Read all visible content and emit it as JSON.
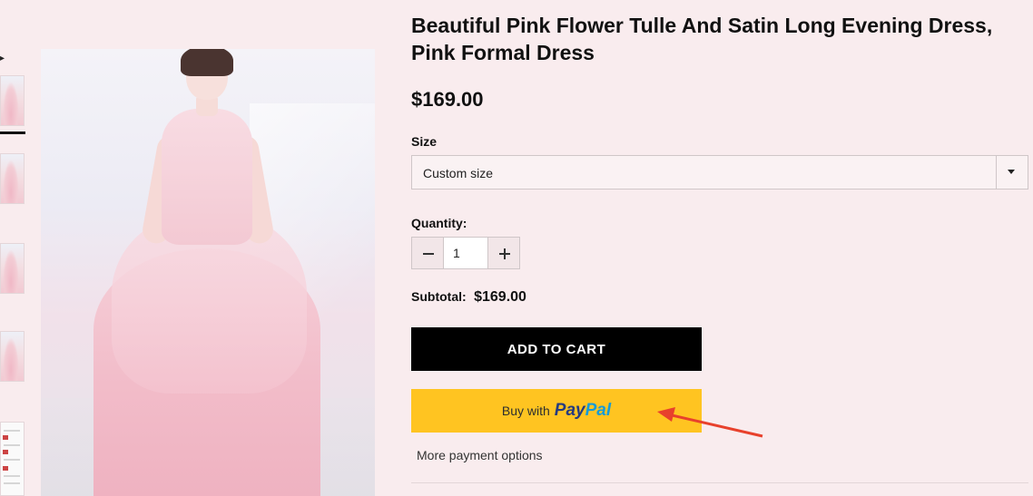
{
  "product": {
    "title": "Beautiful Pink Flower Tulle And Satin Long Evening Dress, Pink Formal Dress",
    "price": "$169.00"
  },
  "size": {
    "label": "Size",
    "selected": "Custom size"
  },
  "quantity": {
    "label": "Quantity:",
    "value": "1"
  },
  "subtotal": {
    "label": "Subtotal:",
    "value": "$169.00"
  },
  "buttons": {
    "add_to_cart": "ADD TO CART",
    "paypal_prefix": "Buy with",
    "paypal_brand_1": "Pay",
    "paypal_brand_2": "Pal",
    "more_payment": "More payment options"
  },
  "colors": {
    "background": "#f9ecee",
    "add_to_cart_bg": "#000000",
    "paypal_bg": "#ffc421",
    "annotation_arrow": "#e8412c"
  },
  "icons": [
    "chevron-down-icon",
    "minus-icon",
    "plus-icon",
    "annotation-arrow-icon"
  ]
}
